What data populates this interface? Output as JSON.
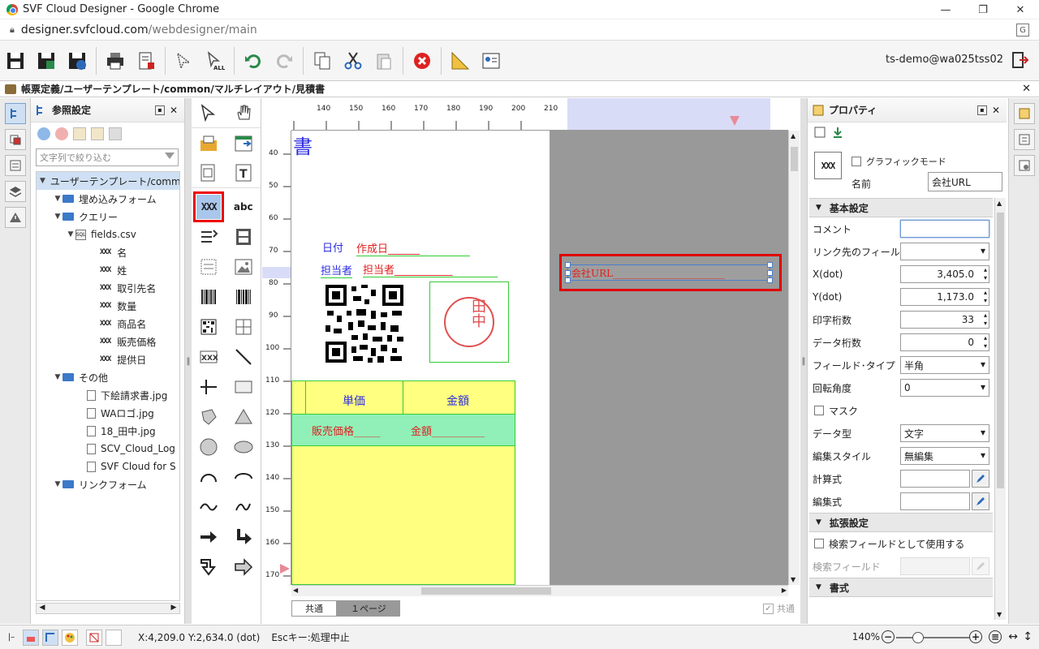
{
  "browser": {
    "window_title": "SVF Cloud Designer - Google Chrome",
    "url_host": "designer.svfcloud.com",
    "url_path": "/webdesigner/main"
  },
  "toolbar": {
    "user": "ts-demo@wa025tss02"
  },
  "breadcrumb": "帳票定義/ユーザーテンプレート/common/マルチレイアウト/見積書",
  "ref_panel": {
    "title": "参照設定",
    "filter_placeholder": "文字列で絞り込む",
    "tree": {
      "root": "ユーザーテンプレート/comm",
      "embedded_form": "埋め込みフォーム",
      "query": "クエリー",
      "csv": "fields.csv",
      "fields": [
        "名",
        "姓",
        "取引先名",
        "数量",
        "商品名",
        "販売価格",
        "提供日"
      ],
      "field_icon": "XXX",
      "other": "その他",
      "files": [
        "下絵請求書.jpg",
        "WAロゴ.jpg",
        "18_田中.jpg",
        "SCV_Cloud_Log",
        "SVF Cloud for S"
      ],
      "link_form": "リンクフォーム"
    }
  },
  "palette": {
    "field_tool": "XXX",
    "text_tool": "abc"
  },
  "canvas": {
    "ruler_top": [
      "140",
      "150",
      "160",
      "170",
      "180",
      "190",
      "200",
      "210"
    ],
    "ruler_left": [
      "40",
      "50",
      "60",
      "70",
      "80",
      "90",
      "100",
      "110",
      "120",
      "130",
      "140",
      "150",
      "160",
      "170"
    ],
    "doc_char": "書",
    "date_label": "日付",
    "date_field": "作成日______",
    "person_label": "担当者",
    "person_field": "担当者___________",
    "stamp_text": "田中",
    "table_header_price": "単価",
    "table_header_amount": "金額",
    "table_cell_price": "販売価格_____",
    "table_cell_amount": "金額__________",
    "selected_field": "会社URL_______________________",
    "tab_common": "共通",
    "tab_page1": "１ページ",
    "common_check": "共通"
  },
  "properties": {
    "title": "プロパティ",
    "preview": "XXX",
    "graphic_mode": "グラフィックモード",
    "name_label": "名前",
    "name_value": "会社URL",
    "section_basic": "基本設定",
    "comment": "コメント",
    "link_field": "リンク先のフィールド名",
    "x_label": "X(dot)",
    "x_value": "3,405.0",
    "y_label": "Y(dot)",
    "y_value": "1,173.0",
    "print_digits": "印字桁数",
    "print_digits_value": "33",
    "data_digits": "データ桁数",
    "data_digits_value": "0",
    "field_type": "フィールド･タイプ",
    "field_type_value": "半角",
    "rotation": "回転角度",
    "rotation_value": "0",
    "mask": "マスク",
    "data_type": "データ型",
    "data_type_value": "文字",
    "edit_style": "編集スタイル",
    "edit_style_value": "無編集",
    "calc": "計算式",
    "edit_formula": "編集式",
    "section_ext": "拡張設定",
    "search_use": "検索フィールドとして使用する",
    "search_field": "検索フィールド",
    "section_format": "書式"
  },
  "status": {
    "coords": "X:4,209.0 Y:2,634.0 (dot)",
    "hint": "Escキー:処理中止",
    "zoom": "140%"
  },
  "colors": {
    "accent_red": "#e00000",
    "selection_blue": "#cfe0f4",
    "table_green": "#90f0b8",
    "table_yellow": "#ffff80"
  }
}
